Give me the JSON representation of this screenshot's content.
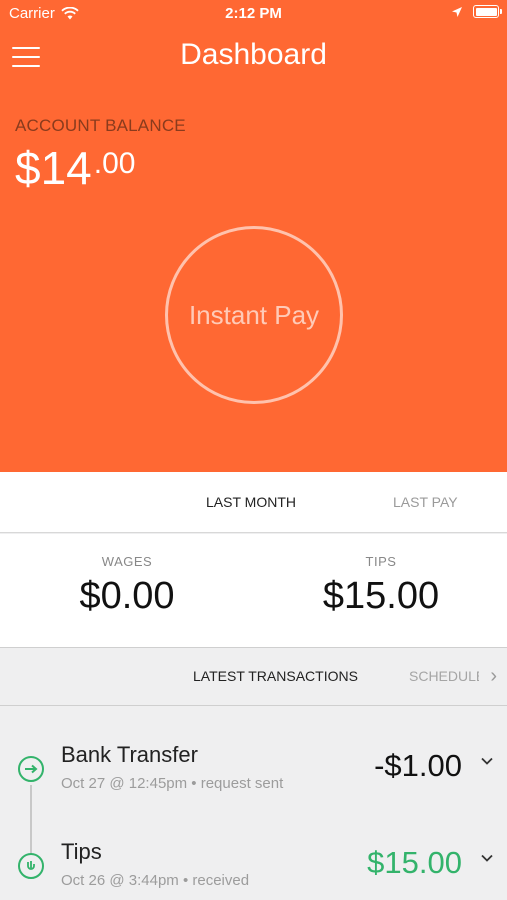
{
  "status_bar": {
    "carrier": "Carrier",
    "time": "2:12 PM"
  },
  "header": {
    "title": "Dashboard"
  },
  "balance": {
    "label": "ACCOUNT BALANCE",
    "dollars": "$14",
    "cents": ".00"
  },
  "instant_pay": {
    "label": "Instant Pay"
  },
  "period_tabs": [
    {
      "label": "LAST MONTH",
      "active": true
    },
    {
      "label": "LAST PAY",
      "active": false
    }
  ],
  "stats": {
    "wages": {
      "label": "WAGES",
      "value": "$0.00"
    },
    "tips": {
      "label": "TIPS",
      "value": "$15.00"
    }
  },
  "tx_tabs": [
    {
      "label": "LATEST TRANSACTIONS",
      "active": true
    },
    {
      "label": "SCHEDULED",
      "active": false
    }
  ],
  "transactions": [
    {
      "title": "Bank Transfer",
      "subtitle": "Oct 27 @ 12:45pm • request sent",
      "amount": "-$1.00",
      "icon": "transfer-icon"
    },
    {
      "title": "Tips",
      "subtitle": "Oct 26 @ 3:44pm • received",
      "amount": "$15.00",
      "icon": "tips-icon"
    }
  ],
  "colors": {
    "brand": "#ff6833",
    "positive": "#33b36b"
  }
}
